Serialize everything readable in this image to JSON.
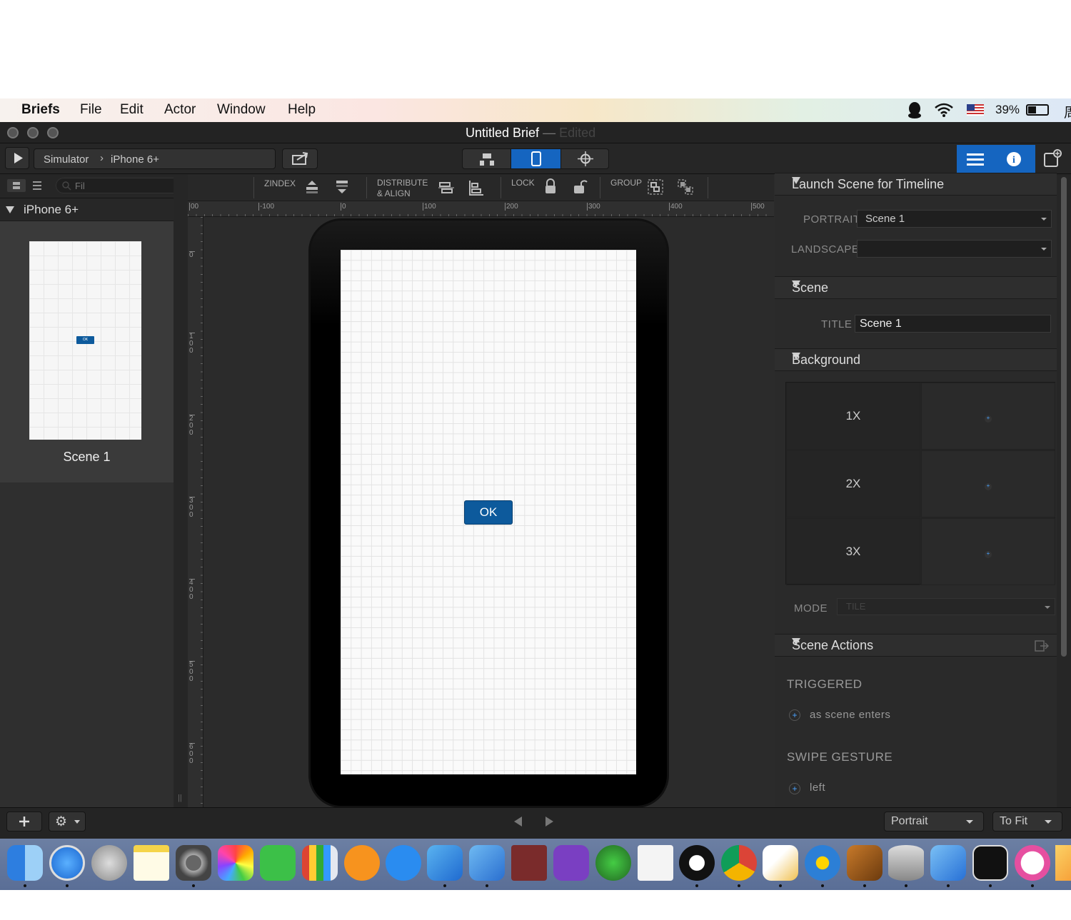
{
  "menubar": {
    "app": "Briefs",
    "items": [
      "File",
      "Edit",
      "Actor",
      "Window",
      "Help"
    ],
    "battery": "39%"
  },
  "window": {
    "title": "Untitled Brief",
    "title_sep": "—",
    "title_status": "Edited"
  },
  "toolbar": {
    "crumb1": "Simulator",
    "crumb2": "iPhone 6+"
  },
  "filter": {
    "placeholder": "Fil"
  },
  "arrange": {
    "zindex": "ZINDEX",
    "distribute1": "DISTRIBUTE",
    "distribute2": "& ALIGN",
    "lock": "LOCK",
    "group": "GROUP"
  },
  "ruler": {
    "h_ticks": [
      "00",
      "-100",
      "0",
      "100",
      "200",
      "300",
      "400",
      "500"
    ],
    "v_ticks": [
      "0",
      "100",
      "200",
      "300",
      "400",
      "500",
      "600"
    ]
  },
  "sidebar": {
    "device": "iPhone 6+",
    "scene_label": "Scene 1",
    "thumb_button": "OK"
  },
  "canvas": {
    "button_label": "OK",
    "button_color": "#0d5a9c"
  },
  "inspector": {
    "launch": {
      "header": "Launch Scene for Timeline",
      "portrait_label": "PORTRAIT",
      "portrait_value": "Scene 1",
      "landscape_label": "LANDSCAPE",
      "landscape_value": ""
    },
    "scene": {
      "header": "Scene",
      "title_label": "TITLE",
      "title_value": "Scene 1"
    },
    "background": {
      "header": "Background",
      "rows": [
        "1X",
        "2X",
        "3X"
      ],
      "mode_label": "MODE",
      "mode_value": "TILE"
    },
    "actions": {
      "header": "Scene Actions",
      "triggered": "TRIGGERED",
      "trigger_item": "as scene enters",
      "swipe": "SWIPE GESTURE",
      "swipe_item": "left"
    }
  },
  "bottombar": {
    "orientation": "Portrait",
    "zoom": "To Fit"
  },
  "dock": {
    "icons": [
      "finder-icon",
      "safari-icon",
      "launchpad-icon",
      "notes-icon",
      "system-preferences-icon",
      "photos-icon",
      "facetime-icon",
      "numbers-icon",
      "ibooks-icon",
      "app-store-icon",
      "xcode-icon",
      "simulator-icon",
      "dictionary-icon",
      "dash-icon",
      "wizard-icon",
      "textedit-icon",
      "qq-icon",
      "chrome-icon",
      "sketch-icon",
      "sourcetree-icon",
      "package-icon",
      "sequel-pro-icon",
      "instruments-icon",
      "terminal-icon",
      "itunes-icon",
      "sketch-gem-icon"
    ]
  }
}
